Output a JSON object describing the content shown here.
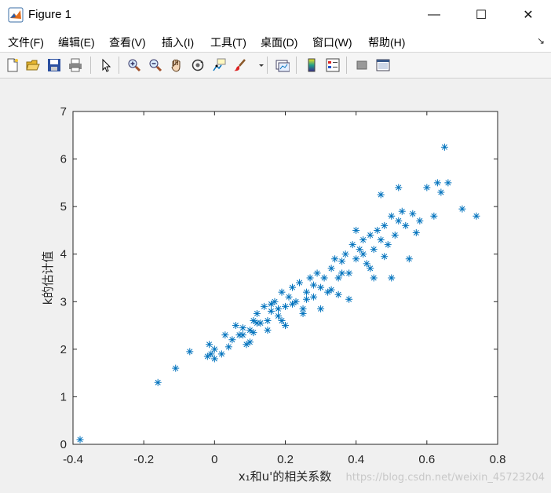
{
  "window": {
    "title": "Figure 1",
    "minimize_glyph": "—",
    "maximize_glyph": "☐",
    "close_glyph": "✕"
  },
  "menubar": {
    "items": [
      {
        "label": "文件(F)"
      },
      {
        "label": "编辑(E)"
      },
      {
        "label": "查看(V)"
      },
      {
        "label": "插入(I)"
      },
      {
        "label": "工具(T)"
      },
      {
        "label": "桌面(D)"
      },
      {
        "label": "窗口(W)"
      },
      {
        "label": "帮助(H)"
      }
    ],
    "overflow_glyph": "↘"
  },
  "toolbar": {
    "buttons": [
      {
        "icon": "new-figure-icon"
      },
      {
        "icon": "open-file-icon"
      },
      {
        "icon": "save-icon"
      },
      {
        "icon": "print-icon"
      },
      {
        "icon": "pointer-icon"
      },
      {
        "icon": "zoom-in-icon"
      },
      {
        "icon": "zoom-out-icon"
      },
      {
        "icon": "pan-icon"
      },
      {
        "icon": "rotate-3d-icon"
      },
      {
        "icon": "data-cursor-icon"
      },
      {
        "icon": "brush-icon"
      },
      {
        "icon": "link-plot-icon"
      },
      {
        "icon": "colorbar-icon"
      },
      {
        "icon": "legend-icon"
      },
      {
        "icon": "hide-plot-tools-icon"
      },
      {
        "icon": "show-plot-tools-icon"
      }
    ]
  },
  "colors": {
    "marker": "#0072bd",
    "axes_bg": "#ffffff",
    "figure_bg": "#f0f0f0"
  },
  "chart_data": {
    "type": "scatter",
    "marker": "*",
    "xlabel": "x₁和u'的相关系数",
    "ylabel": "k的估计值",
    "xlim": [
      -0.4,
      0.8
    ],
    "ylim": [
      0,
      7
    ],
    "xticks": [
      "-0.4",
      "-0.2",
      "0",
      "0.2",
      "0.4",
      "0.6",
      "0.8"
    ],
    "yticks": [
      "0",
      "1",
      "2",
      "3",
      "4",
      "5",
      "6",
      "7"
    ],
    "grid": false,
    "points": [
      [
        -0.38,
        0.1
      ],
      [
        -0.16,
        1.3
      ],
      [
        -0.11,
        1.6
      ],
      [
        -0.07,
        1.95
      ],
      [
        -0.02,
        1.85
      ],
      [
        -0.01,
        1.9
      ],
      [
        0.0,
        1.8
      ],
      [
        -0.015,
        2.1
      ],
      [
        0.0,
        2.0
      ],
      [
        0.02,
        1.9
      ],
      [
        0.03,
        2.3
      ],
      [
        0.04,
        2.05
      ],
      [
        0.05,
        2.2
      ],
      [
        0.06,
        2.5
      ],
      [
        0.07,
        2.3
      ],
      [
        0.08,
        2.45
      ],
      [
        0.09,
        2.1
      ],
      [
        0.1,
        2.4
      ],
      [
        0.11,
        2.6
      ],
      [
        0.12,
        2.75
      ],
      [
        0.13,
        2.55
      ],
      [
        0.14,
        2.9
      ],
      [
        0.15,
        2.6
      ],
      [
        0.16,
        2.8
      ],
      [
        0.17,
        3.0
      ],
      [
        0.18,
        2.7
      ],
      [
        0.19,
        3.2
      ],
      [
        0.2,
        2.9
      ],
      [
        0.21,
        3.1
      ],
      [
        0.22,
        3.3
      ],
      [
        0.23,
        3.0
      ],
      [
        0.24,
        3.4
      ],
      [
        0.25,
        2.85
      ],
      [
        0.26,
        3.2
      ],
      [
        0.27,
        3.5
      ],
      [
        0.28,
        3.1
      ],
      [
        0.29,
        3.6
      ],
      [
        0.3,
        3.3
      ],
      [
        0.31,
        3.5
      ],
      [
        0.32,
        3.2
      ],
      [
        0.33,
        3.7
      ],
      [
        0.34,
        3.9
      ],
      [
        0.35,
        3.5
      ],
      [
        0.36,
        3.85
      ],
      [
        0.37,
        4.0
      ],
      [
        0.38,
        3.6
      ],
      [
        0.39,
        4.2
      ],
      [
        0.4,
        3.9
      ],
      [
        0.41,
        4.1
      ],
      [
        0.42,
        4.3
      ],
      [
        0.43,
        3.8
      ],
      [
        0.44,
        4.4
      ],
      [
        0.45,
        4.1
      ],
      [
        0.46,
        4.5
      ],
      [
        0.47,
        4.3
      ],
      [
        0.48,
        4.6
      ],
      [
        0.49,
        4.2
      ],
      [
        0.5,
        4.8
      ],
      [
        0.51,
        4.4
      ],
      [
        0.52,
        4.7
      ],
      [
        0.53,
        4.9
      ],
      [
        0.54,
        4.6
      ],
      [
        0.56,
        4.85
      ],
      [
        0.58,
        4.7
      ],
      [
        0.6,
        5.4
      ],
      [
        0.62,
        4.8
      ],
      [
        0.63,
        5.5
      ],
      [
        0.64,
        5.3
      ],
      [
        0.65,
        6.25
      ],
      [
        0.66,
        5.5
      ],
      [
        0.7,
        4.95
      ],
      [
        0.74,
        4.8
      ],
      [
        0.47,
        5.25
      ],
      [
        0.5,
        3.5
      ],
      [
        0.38,
        3.05
      ],
      [
        0.3,
        2.85
      ],
      [
        0.2,
        2.5
      ],
      [
        0.1,
        2.15
      ],
      [
        0.55,
        3.9
      ],
      [
        0.45,
        3.5
      ],
      [
        0.35,
        3.15
      ],
      [
        0.25,
        2.75
      ],
      [
        0.15,
        2.4
      ],
      [
        0.42,
        4.0
      ],
      [
        0.36,
        3.6
      ],
      [
        0.28,
        3.35
      ],
      [
        0.22,
        2.95
      ],
      [
        0.18,
        2.85
      ],
      [
        0.12,
        2.55
      ],
      [
        0.08,
        2.3
      ],
      [
        0.4,
        4.5
      ],
      [
        0.52,
        5.4
      ],
      [
        0.57,
        4.45
      ],
      [
        0.48,
        3.95
      ],
      [
        0.44,
        3.7
      ],
      [
        0.33,
        3.25
      ],
      [
        0.26,
        3.05
      ],
      [
        0.19,
        2.6
      ],
      [
        0.16,
        2.95
      ],
      [
        0.11,
        2.35
      ]
    ]
  },
  "watermark": "https://blog.csdn.net/weixin_45723204"
}
